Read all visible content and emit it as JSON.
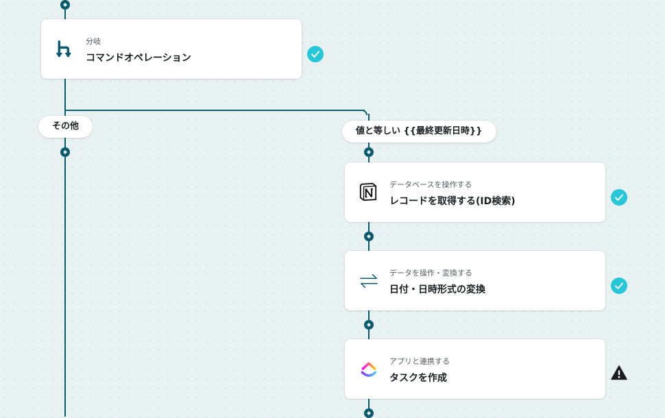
{
  "colors": {
    "wire": "#0b5a6e",
    "check": "#27c6d8",
    "warning": "#1a1d21",
    "background": "#e9f2f2"
  },
  "branch_labels": {
    "other": "その他",
    "equals": "値と等しい {{最終更新日時}}"
  },
  "steps": [
    {
      "icon": "branch-icon",
      "subtitle": "分岐",
      "title": "コマンドオペレーション",
      "status": "check"
    },
    {
      "icon": "notion-icon",
      "subtitle": "データベースを操作する",
      "title": "レコードを取得する(ID検索)",
      "status": "check"
    },
    {
      "icon": "convert-arrows-icon",
      "subtitle": "データを操作・変換する",
      "title": "日付・日時形式の変換",
      "status": "check"
    },
    {
      "icon": "clickup-icon",
      "subtitle": "アプリと連携する",
      "title": "タスクを作成",
      "status": "warning"
    }
  ]
}
